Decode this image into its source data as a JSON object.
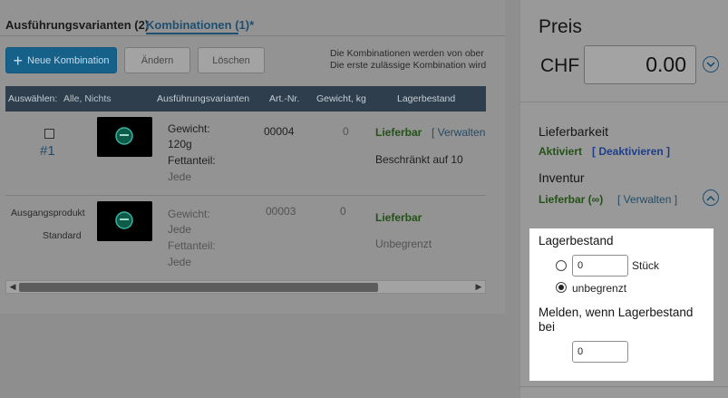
{
  "tabs": {
    "variants": "Ausführungsvarianten (2)",
    "combinations": "Kombinationen (1)*"
  },
  "toolbar": {
    "new_label": "Neue Kombination",
    "edit_label": "Ändern",
    "delete_label": "Löschen",
    "info_line1": "Die Kombinationen werden von ober",
    "info_line2": "Die erste zulässige Kombination wird"
  },
  "table": {
    "select_label": "Auswählen:",
    "select_options": "Alle, Nichts",
    "columns": [
      "Ausführungsvarianten",
      "Art.-Nr.",
      "Gewicht, kg",
      "Lagerbestand"
    ],
    "rows": [
      {
        "number": "#1",
        "attr1_label": "Gewicht:",
        "attr1_value": "120g",
        "attr2_label": "Fettanteil:",
        "attr2_value": "Jede",
        "art_nr": "00004",
        "weight": "0",
        "status": "Lieferbar",
        "manage": "[ Verwalten",
        "stock": "Beschränkt auf 10"
      },
      {
        "label1": "Ausgangsprodukt",
        "label2": "Standard",
        "attr1_label": "Gewicht:",
        "attr1_value": "Jede",
        "attr2_label": "Fettanteil:",
        "attr2_value": "Jede",
        "art_nr": "00003",
        "weight": "0",
        "status": "Lieferbar",
        "stock": "Unbegrenzt"
      }
    ]
  },
  "scrollbar": {
    "position": 0.0
  },
  "price": {
    "title": "Preis",
    "currency": "CHF",
    "value": "0.00"
  },
  "availability": {
    "title": "Lieferbarkeit",
    "status": "Aktiviert",
    "action": "[ Deaktivieren ]"
  },
  "inventory": {
    "title": "Inventur",
    "status": "Lieferbar (∞)",
    "action": "[ Verwalten ]"
  },
  "stock_box": {
    "title": "Lagerbestand",
    "quantity_value": "0",
    "unit": "Stück",
    "unlimited_label": "unbegrenzt",
    "selected": "unbegrenzt",
    "notify_line1": "Melden, wenn Lagerbestand",
    "notify_line2": "bei",
    "notify_value": "0"
  },
  "colors": {
    "accent": "#16618a",
    "link": "#244b66",
    "available_green": "#235216",
    "table_header": "#2e3e4c"
  }
}
